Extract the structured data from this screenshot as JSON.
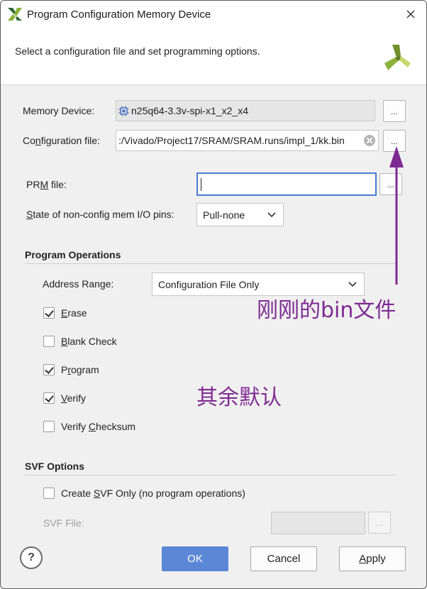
{
  "window": {
    "title": "Program Configuration Memory Device",
    "subtitle": "Select a configuration file and set programming options."
  },
  "memory_device": {
    "label": "Memory Device:",
    "value": "n25q64-3.3v-spi-x1_x2_x4",
    "browse_label": "..."
  },
  "config_file": {
    "label_pre": "Co",
    "label_u": "n",
    "label_post": "figuration file:",
    "value": ":/Vivado/Project17/SRAM/SRAM.runs/impl_1/kk.bin",
    "browse_label": "..."
  },
  "prm_file": {
    "label_pre": "PR",
    "label_u": "M",
    "label_post": " file:",
    "value": "",
    "browse_label": "..."
  },
  "state_pins": {
    "label_pre": "",
    "label_u": "S",
    "label_post": "tate of non-config mem I/O pins:",
    "value": "Pull-none"
  },
  "program_operations": {
    "title": "Program Operations",
    "address_range_label": "Address Range:",
    "address_range_value": "Configuration File Only",
    "items": [
      {
        "pre": "",
        "u": "E",
        "post": "rase",
        "checked": true
      },
      {
        "pre": "",
        "u": "B",
        "post": "lank Check",
        "checked": false
      },
      {
        "pre": "P",
        "u": "r",
        "post": "ogram",
        "checked": true
      },
      {
        "pre": "",
        "u": "V",
        "post": "erify",
        "checked": true
      },
      {
        "pre": "Verify ",
        "u": "C",
        "post": "hecksum",
        "checked": false
      }
    ]
  },
  "svf_options": {
    "title": "SVF Options",
    "create_pre": "Create ",
    "create_u": "S",
    "create_post": "VF Only (no program operations)",
    "create_checked": false,
    "svf_file_label": "SVF File:",
    "svf_file_value": "",
    "browse_label": "..."
  },
  "buttons": {
    "help": "?",
    "ok": "OK",
    "cancel": "Cancel",
    "apply_u": "A",
    "apply_post": "pply"
  },
  "annotations": {
    "bin_note": "刚刚的bin文件",
    "default_note": "其余默认"
  },
  "colors": {
    "accent": "#5c87d6",
    "annotation": "#7e2a93",
    "brand_green": "#8cb43c",
    "focus_border": "#4a7bd3"
  },
  "icons": {
    "app": "xilinx-logo-icon",
    "close": "close-icon",
    "chip": "chip-icon",
    "clear": "clear-icon",
    "dropdown": "chevron-down-icon",
    "arrow": "arrow-up-icon"
  }
}
